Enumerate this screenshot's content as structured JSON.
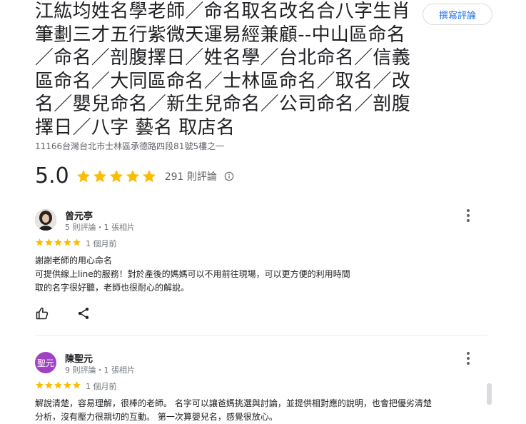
{
  "place": {
    "title": "江紘均姓名學老師／命名取名改名合八字生肖筆劃三才五行紫微天運易經兼顧--中山區命名／命名／剖腹擇日／姓名學／台北命名／信義區命名／大同區命名／士林區命名／取名／改名／嬰兒命名／新生兒命名／公司命名／剖腹擇日／八字 藝名 取店名",
    "address": "11166台灣台北市士林區承德路四段81號5樓之一",
    "rating": "5.0",
    "review_count": "291 則評論",
    "write_review": "撰寫評論"
  },
  "reviews": [
    {
      "name": "曾元亭",
      "meta": "5 則評論・1 張相片",
      "time": "1 個月前",
      "stars": 5,
      "avatar": "photo",
      "lines": [
        "謝謝老師的用心命名",
        "可提供線上line的服務！對於產後的媽媽可以不用前往現場，可以更方便的利用時間",
        "取的名字很好聽，老師也很耐心的解說。"
      ]
    },
    {
      "name": "陳聖元",
      "meta": "9 則評論・1 張相片",
      "time": "1 個月前",
      "stars": 5,
      "avatar": "initials",
      "avatar_text": "聖元",
      "avatar_color": "#a142c4",
      "lines": [
        "解說清楚，容易理解，很棒的老師。 名字可以讓爸媽挑選與討論，並提供相對應的說明，也會把優劣清楚",
        "分析，沒有壓力很親切的互動。 第一次算嬰兒名，感覺很放心。"
      ]
    }
  ],
  "colors": {
    "star": "#fbbc04",
    "link": "#1a73e8",
    "muted": "#5f6368"
  }
}
